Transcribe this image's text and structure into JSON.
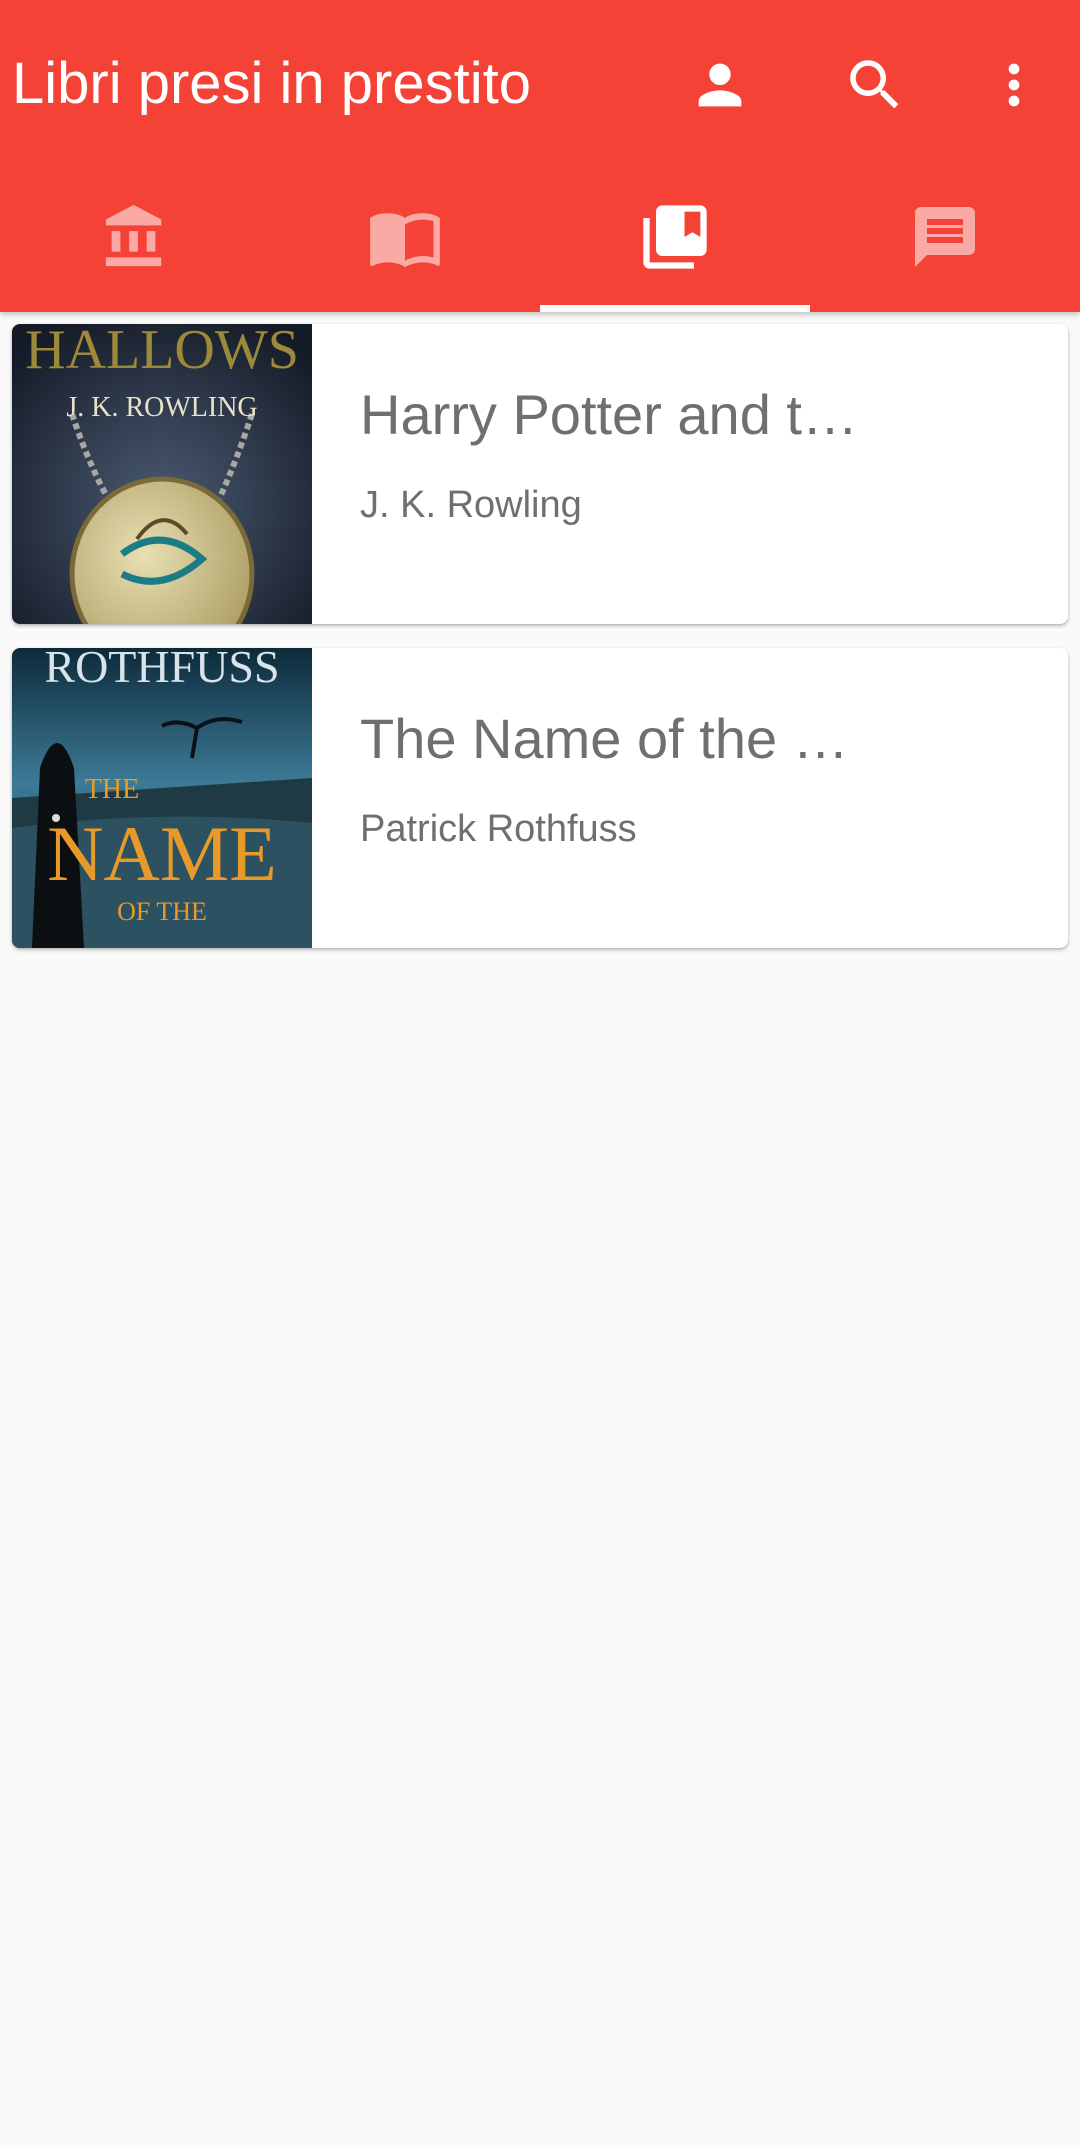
{
  "header": {
    "title": "Libri presi in prestito",
    "actions": [
      {
        "name": "account-button",
        "icon": "person-icon"
      },
      {
        "name": "search-button",
        "icon": "search-icon"
      },
      {
        "name": "more-options-button",
        "icon": "more-vert-icon"
      }
    ],
    "tabs": [
      {
        "name": "tab-library",
        "icon": "library-icon",
        "active": false
      },
      {
        "name": "tab-books",
        "icon": "open-book-icon",
        "active": false
      },
      {
        "name": "tab-borrowed",
        "icon": "collections-bookmark-icon",
        "active": true
      },
      {
        "name": "tab-messages",
        "icon": "message-icon",
        "active": false
      }
    ]
  },
  "books": [
    {
      "title": "Harry Potter and t…",
      "author": "J. K. Rowling",
      "cover_text": [
        "HALLOWS",
        "J. K. ROWLING"
      ]
    },
    {
      "title": "The Name of the …",
      "author": "Patrick Rothfuss",
      "cover_text": [
        "ROTHFUSS",
        "THE",
        "NAME",
        "OF THE"
      ]
    }
  ],
  "colors": {
    "primary": "#f44336",
    "background": "#fafafa",
    "text_secondary": "#6f6f6f"
  }
}
